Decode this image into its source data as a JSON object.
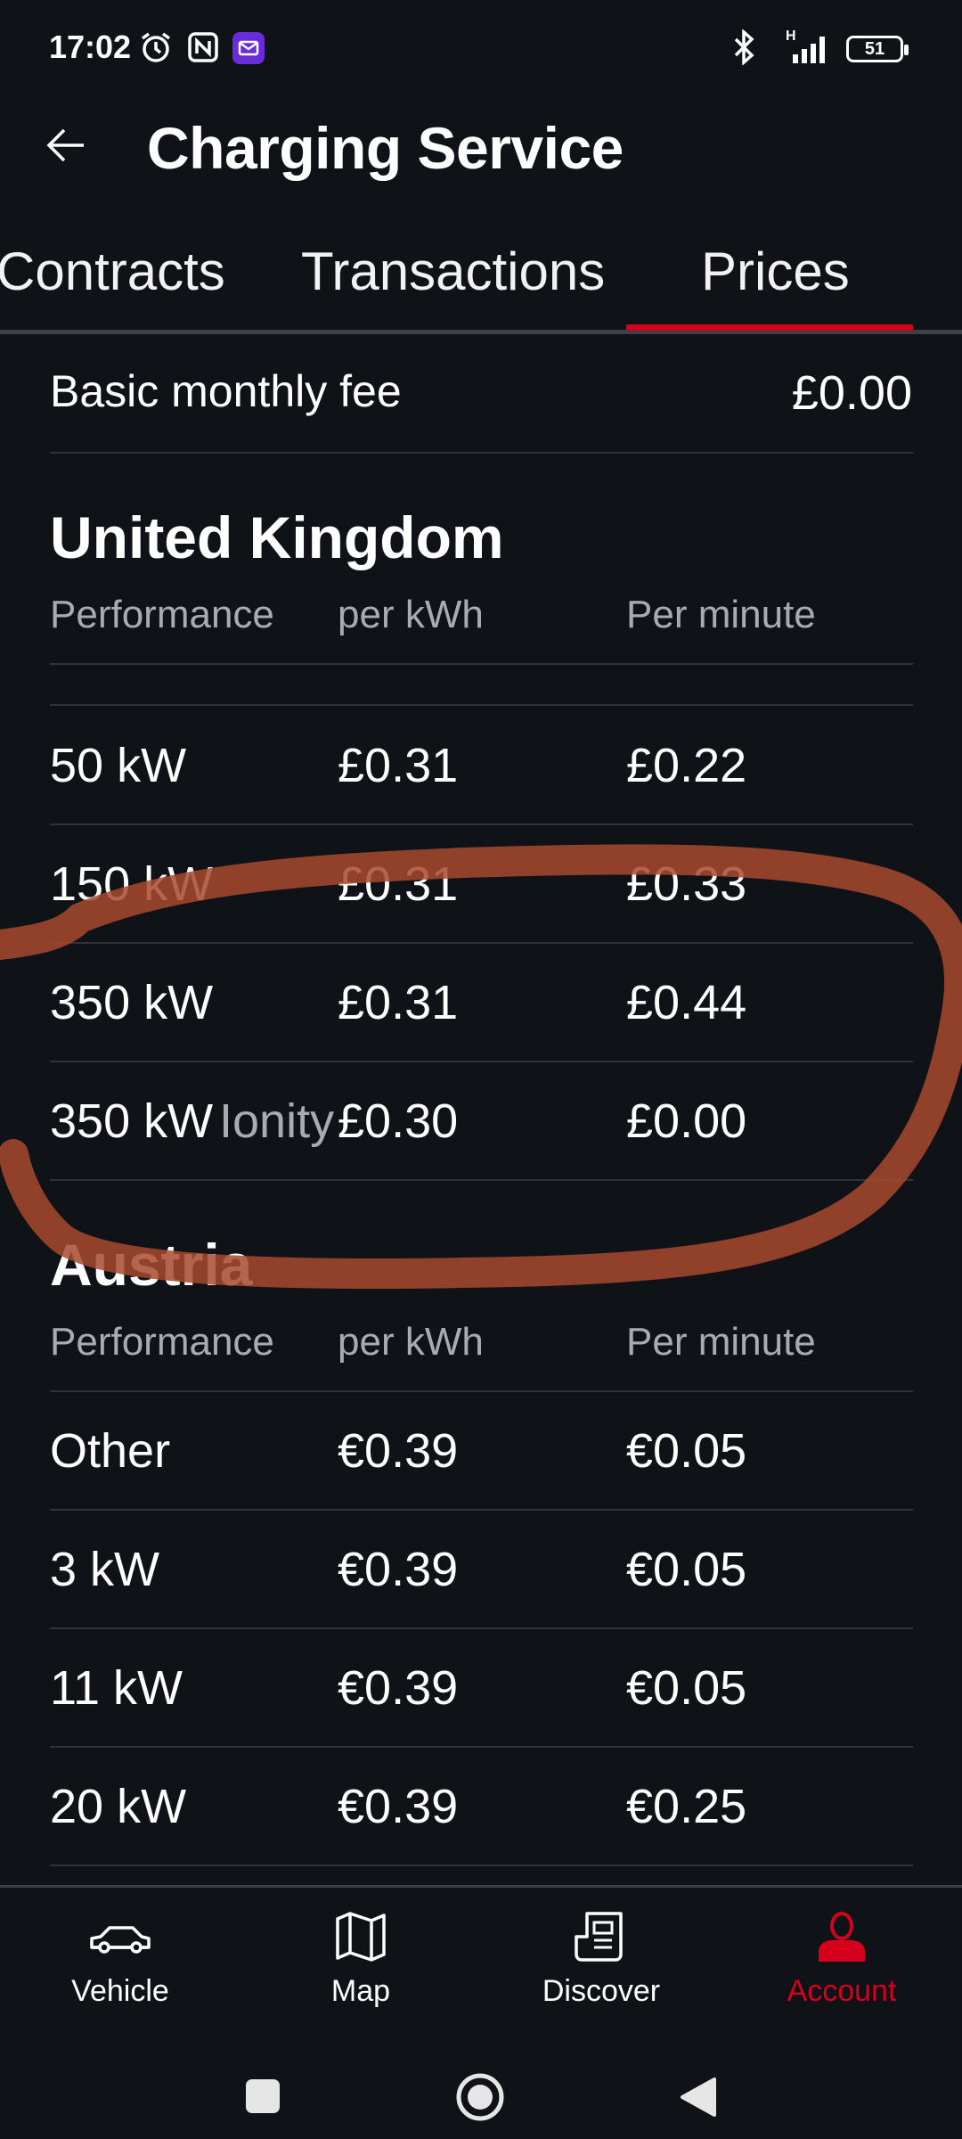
{
  "status_bar": {
    "time": "17:02",
    "battery": "51",
    "network_label": "H"
  },
  "header": {
    "title": "Charging Service"
  },
  "tabs": [
    {
      "label": "Contracts"
    },
    {
      "label": "Transactions"
    },
    {
      "label": "Prices",
      "active": true
    }
  ],
  "basic_fee": {
    "label": "Basic monthly fee",
    "value": "£0.00"
  },
  "sections": [
    {
      "country": "United Kingdom",
      "columns": [
        "Performance",
        "per kWh",
        "Per minute"
      ],
      "rows": [
        {
          "performance": "50 kW",
          "suffix": "",
          "per_kwh": "£0.31",
          "per_minute": "£0.22"
        },
        {
          "performance": "150 kW",
          "suffix": "",
          "per_kwh": "£0.31",
          "per_minute": "£0.33"
        },
        {
          "performance": "350 kW",
          "suffix": "",
          "per_kwh": "£0.31",
          "per_minute": "£0.44"
        },
        {
          "performance": "350 kW",
          "suffix": "Ionity",
          "per_kwh": "£0.30",
          "per_minute": "£0.00"
        }
      ]
    },
    {
      "country": "Austria",
      "columns": [
        "Performance",
        "per kWh",
        "Per minute"
      ],
      "rows": [
        {
          "performance": "Other",
          "suffix": "",
          "per_kwh": "€0.39",
          "per_minute": "€0.05"
        },
        {
          "performance": "3 kW",
          "suffix": "",
          "per_kwh": "€0.39",
          "per_minute": "€0.05"
        },
        {
          "performance": "11 kW",
          "suffix": "",
          "per_kwh": "€0.39",
          "per_minute": "€0.05"
        },
        {
          "performance": "20 kW",
          "suffix": "",
          "per_kwh": "€0.39",
          "per_minute": "€0.25"
        }
      ]
    }
  ],
  "bottom_nav": [
    {
      "label": "Vehicle",
      "icon": "car-icon"
    },
    {
      "label": "Map",
      "icon": "map-icon"
    },
    {
      "label": "Discover",
      "icon": "newspaper-icon"
    },
    {
      "label": "Account",
      "icon": "person-icon",
      "active": true
    }
  ],
  "colors": {
    "background": "#0f1217",
    "accent": "#d5001c",
    "annotation": "#a84a2e",
    "muted_text": "#a8abb0"
  }
}
